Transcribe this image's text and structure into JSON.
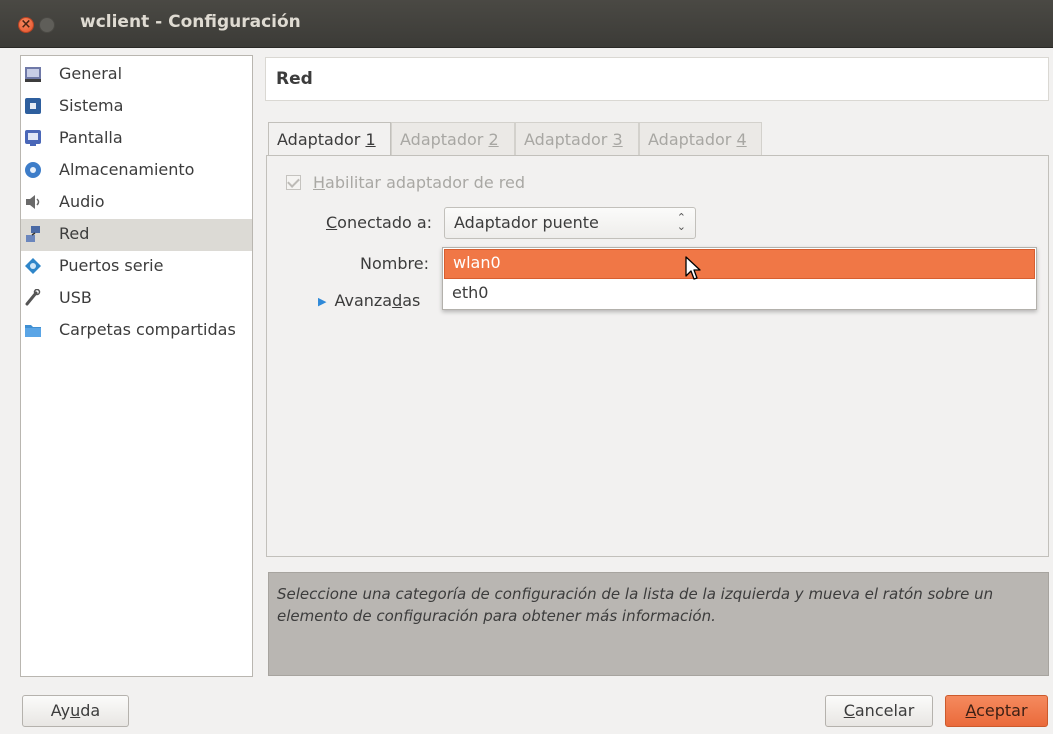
{
  "window": {
    "title": "wclient - Configuración",
    "close_glyph": "×"
  },
  "sidebar": {
    "items": [
      {
        "label": "General",
        "icon": "general-icon",
        "color": "#5f6a9c"
      },
      {
        "label": "Sistema",
        "icon": "system-icon",
        "color": "#3c6fb5"
      },
      {
        "label": "Pantalla",
        "icon": "display-icon",
        "color": "#4a67b8"
      },
      {
        "label": "Almacenamiento",
        "icon": "storage-icon",
        "color": "#3d7dc9"
      },
      {
        "label": "Audio",
        "icon": "audio-icon",
        "color": "#6a6a6a"
      },
      {
        "label": "Red",
        "icon": "network-icon",
        "color": "#4b6aa5",
        "selected": true
      },
      {
        "label": "Puertos serie",
        "icon": "serial-ports-icon",
        "color": "#2f86c9"
      },
      {
        "label": "USB",
        "icon": "usb-icon",
        "color": "#555555"
      },
      {
        "label": "Carpetas compartidas",
        "icon": "shared-folders-icon",
        "color": "#3f8fd2"
      }
    ]
  },
  "header": {
    "title": "Red"
  },
  "tabs": [
    {
      "pre": "Adaptador ",
      "key": "1",
      "active": true
    },
    {
      "pre": "Adaptador ",
      "key": "2",
      "active": false
    },
    {
      "pre": "Adaptador ",
      "key": "3",
      "active": false
    },
    {
      "pre": "Adaptador ",
      "key": "4",
      "active": false
    }
  ],
  "adapter": {
    "enable_pre": "",
    "enable_key": "H",
    "enable_post": "abilitar adaptador de red",
    "enable_checked": true,
    "enable_disabled": true,
    "connected_pre": "",
    "connected_key": "C",
    "connected_post": "onectado a:",
    "connected_value": "Adaptador puente",
    "combo_arrows": "⌃⌄",
    "name_label": "Nombre:",
    "name_options": [
      "wlan0",
      "eth0"
    ],
    "name_highlighted": "wlan0",
    "advanced_pre": "Avanza",
    "advanced_key": "d",
    "advanced_post": "as"
  },
  "info_text": "Seleccione una categoría de configuración de la lista de la izquierda y mueva el ratón sobre un elemento de configuración para obtener más información.",
  "buttons": {
    "help_pre": "Ay",
    "help_key": "u",
    "help_post": "da",
    "cancel_pre": "",
    "cancel_key": "C",
    "cancel_post": "ancelar",
    "ok_pre": "",
    "ok_key": "A",
    "ok_post": "ceptar"
  },
  "colors": {
    "accent": "#f07746",
    "selection": "#dcdad5",
    "titlebar": "#3c3b37"
  }
}
